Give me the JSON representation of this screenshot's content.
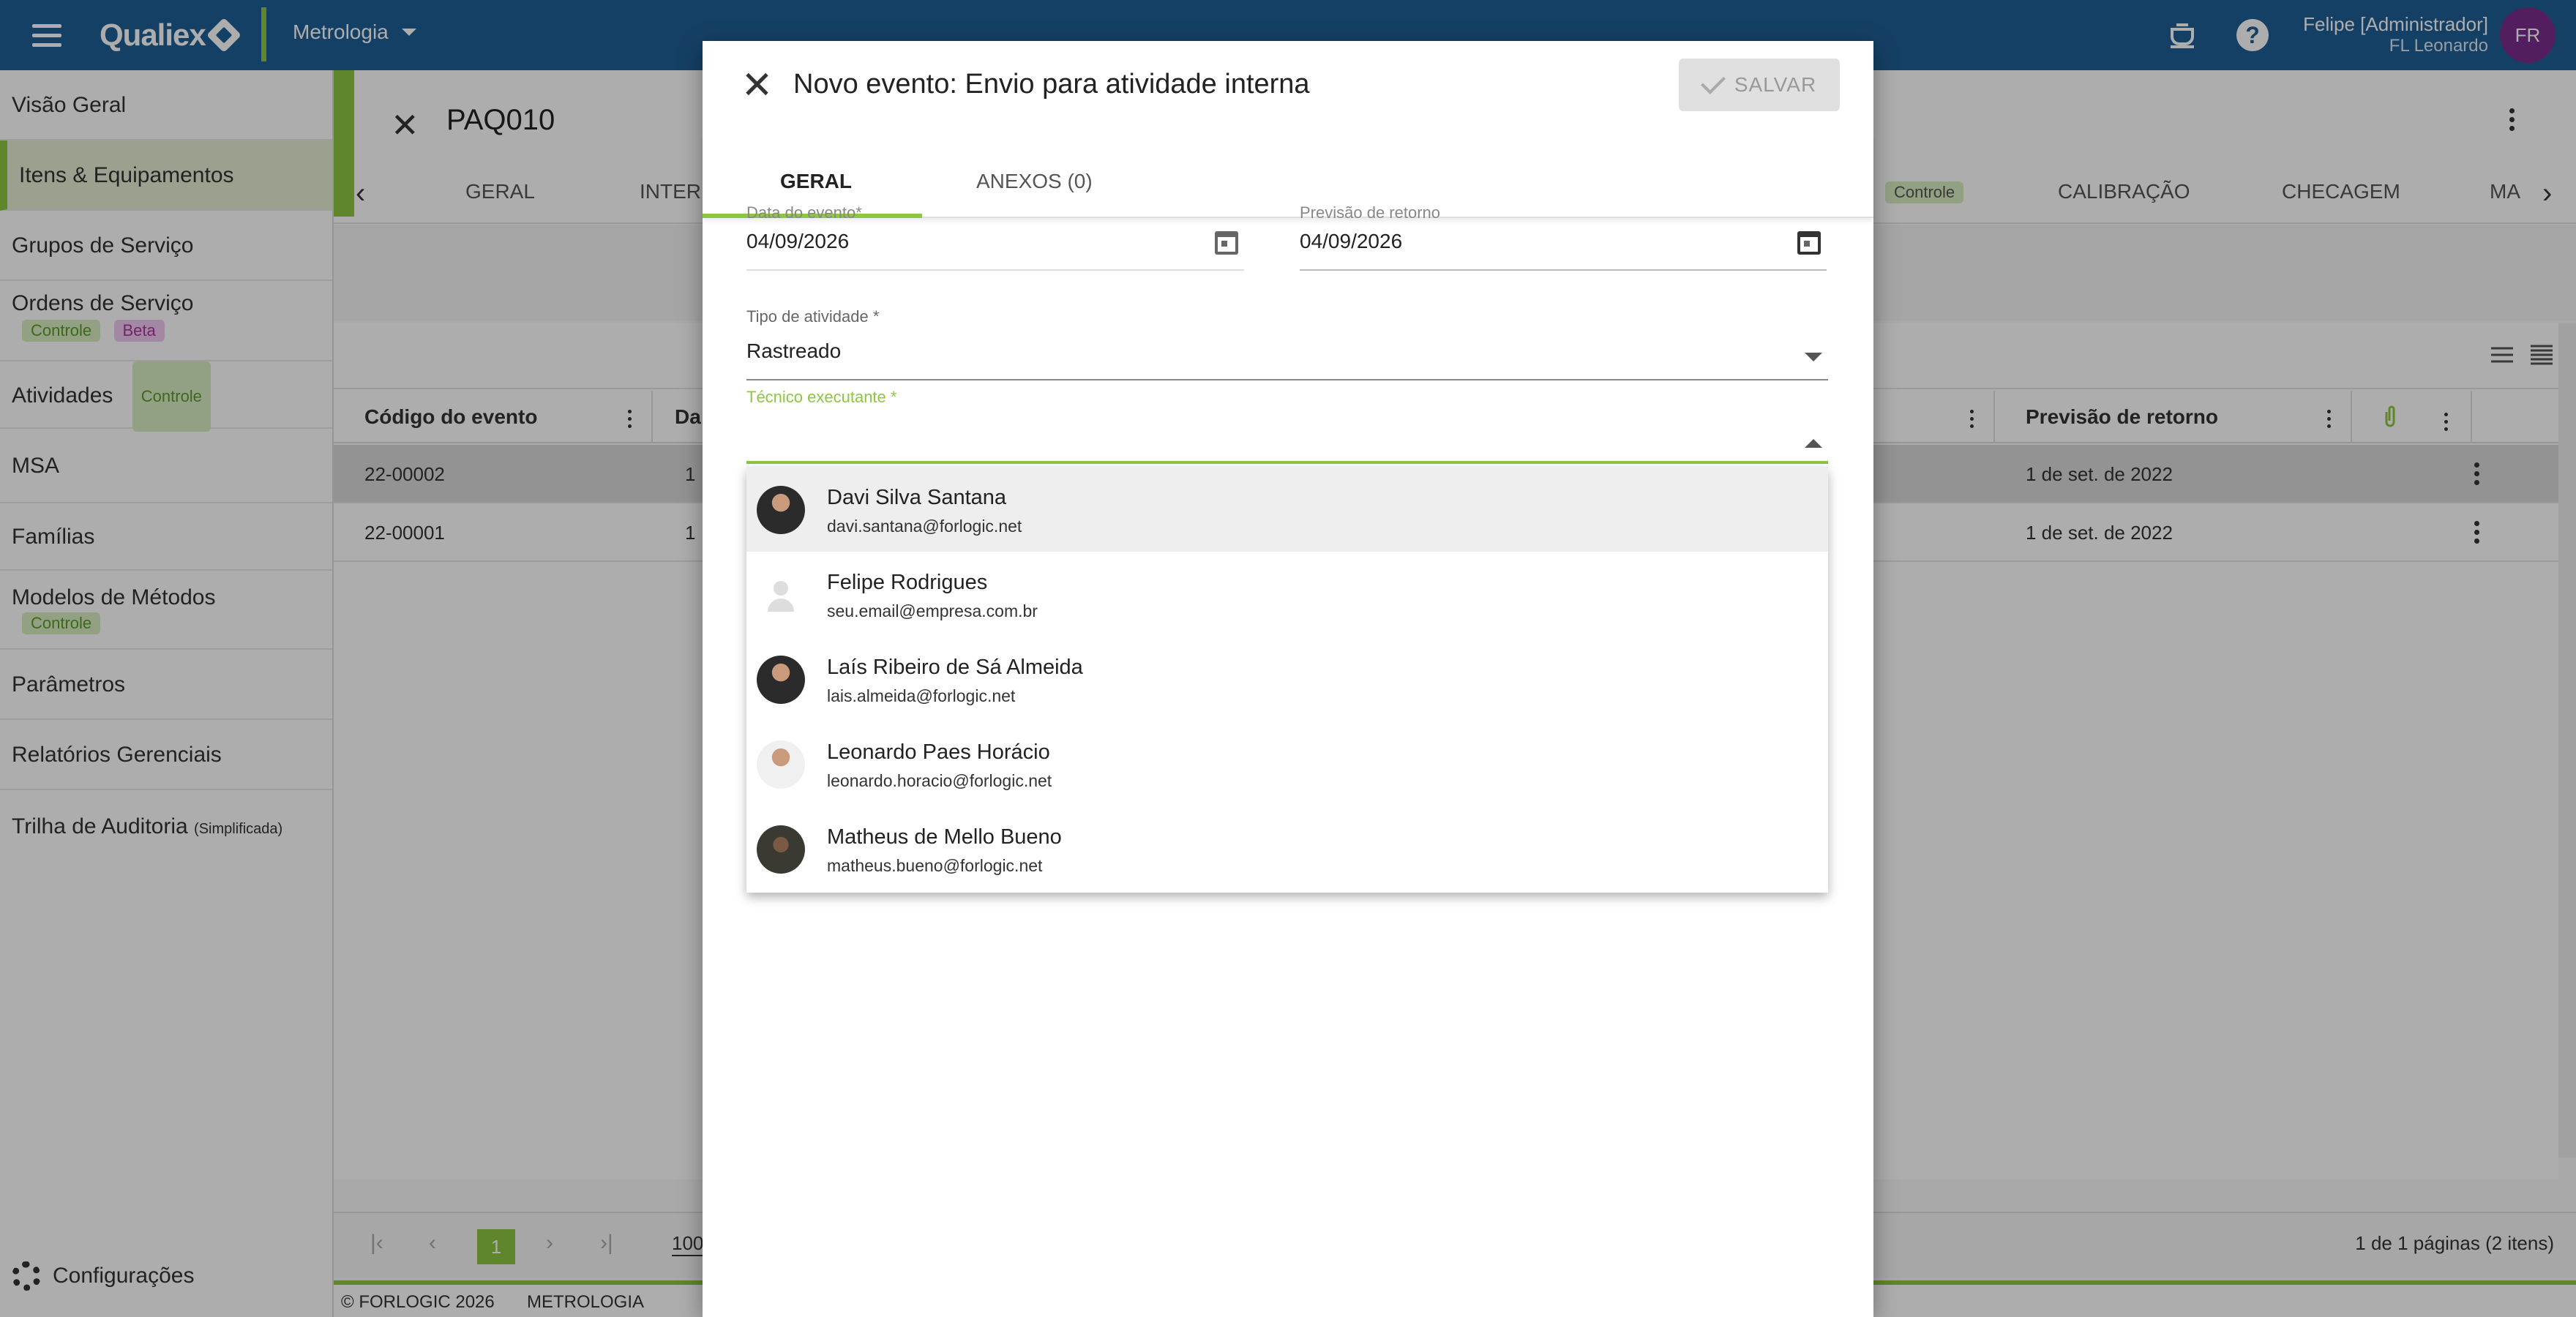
{
  "topbar": {
    "brand": "Qualiex",
    "module": "Metrologia",
    "user_name": "Felipe [Administrador]",
    "user_sub": "FL Leonardo",
    "user_initials": "FR",
    "help_glyph": "?"
  },
  "sidebar": {
    "items": [
      {
        "label": "Visão Geral"
      },
      {
        "label": "Itens & Equipamentos"
      },
      {
        "label": "Grupos de Serviço"
      },
      {
        "label": "Ordens de Serviço",
        "chips": [
          "Controle",
          "Beta"
        ]
      },
      {
        "label": "Atividades",
        "chip": "Controle"
      },
      {
        "label": "MSA"
      },
      {
        "label": "Famílias"
      },
      {
        "label": "Modelos de Métodos",
        "chip": "Controle"
      },
      {
        "label": "Parâmetros"
      },
      {
        "label": "Relatórios Gerenciais"
      },
      {
        "label": "Trilha de Auditoria",
        "note": "(Simplificada)"
      }
    ],
    "config_label": "Configurações"
  },
  "main": {
    "title": "PAQ010",
    "tabs": [
      "GERAL",
      "INTER",
      "Controle",
      "CALIBRAÇÃO",
      "CHECAGEM",
      "MA"
    ],
    "columns": [
      "Código do evento",
      "Da",
      "Previsão de retorno"
    ],
    "rows": [
      {
        "code": "22-00002",
        "date": "1",
        "return": "1 de set. de 2022"
      },
      {
        "code": "22-00001",
        "date": "1",
        "return": "1 de set. de 2022"
      }
    ],
    "pagination": {
      "current": "1",
      "page_size": "100",
      "summary": "1 de 1 páginas (2 itens)"
    },
    "footer": {
      "copyright": "© FORLOGIC 2026",
      "module": "METROLOGIA"
    }
  },
  "dialog": {
    "title": "Novo evento: Envio para atividade interna",
    "save_label": "SALVAR",
    "tabs": [
      {
        "label": "GERAL"
      },
      {
        "label": "ANEXOS (0)"
      }
    ],
    "fields": {
      "event_date": {
        "label": "Data do evento*",
        "value": "04/09/2026"
      },
      "return_date": {
        "label": "Previsão de retorno",
        "value": "04/09/2026"
      },
      "activity_type": {
        "label": "Tipo de atividade *",
        "value": "Rastreado"
      },
      "technician": {
        "label": "Técnico executante *",
        "value": ""
      }
    },
    "options": [
      {
        "name": "Davi Silva Santana",
        "email": "davi.santana@forlogic.net",
        "avatar": "photo"
      },
      {
        "name": "Felipe Rodrigues",
        "email": "seu.email@empresa.com.br",
        "avatar": "placeholder"
      },
      {
        "name": "Laís Ribeiro de Sá Almeida",
        "email": "lais.almeida@forlogic.net",
        "avatar": "photo"
      },
      {
        "name": "Leonardo Paes Horácio",
        "email": "leonardo.horacio@forlogic.net",
        "avatar": "photo"
      },
      {
        "name": "Matheus de Mello Bueno",
        "email": "matheus.bueno@forlogic.net",
        "avatar": "photo"
      }
    ]
  },
  "colors": {
    "topbar": "#1f5f96",
    "accent": "#8dc63f",
    "avatar_bg": "#7b2d8e"
  }
}
